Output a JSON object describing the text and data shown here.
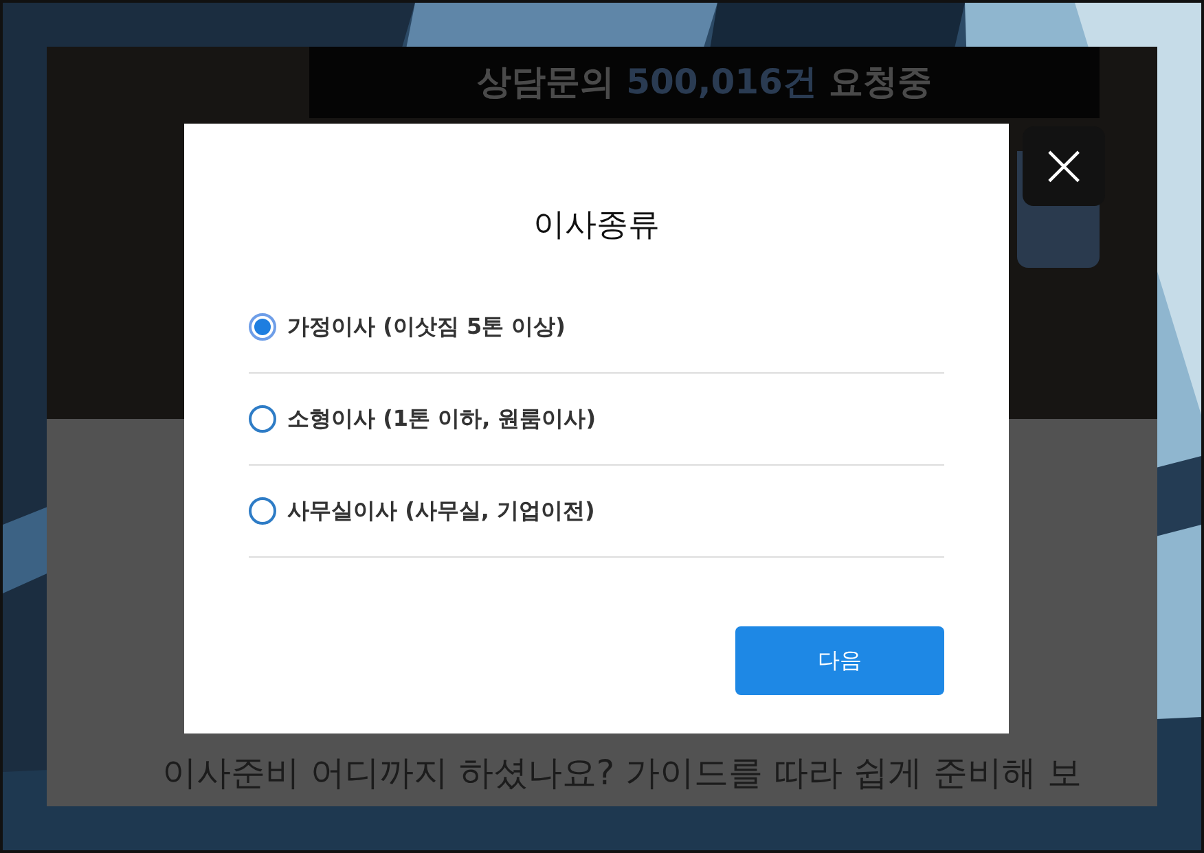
{
  "page": {
    "banner_prefix": "상담문의 ",
    "banner_count": "500,016건",
    "banner_suffix": " 요청중",
    "subtitle": "이사준비 어디까지 하셨나요? 가이드를 따라 쉽게 준비해 보"
  },
  "dialog": {
    "title": "이사종류",
    "close_icon": "×",
    "options": [
      {
        "label": "가정이사 (이삿짐 5톤 이상)",
        "selected": true
      },
      {
        "label": "소형이사 (1톤 이하, 원룸이사)",
        "selected": false
      },
      {
        "label": "사무실이사 (사무실, 기업이전)",
        "selected": false
      }
    ],
    "next_button": "다음"
  }
}
